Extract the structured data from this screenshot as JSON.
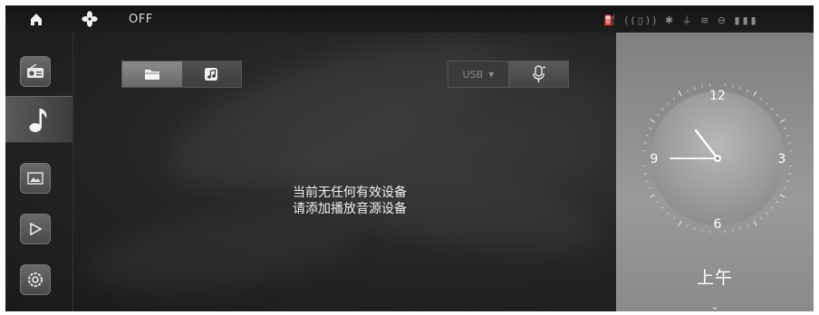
{
  "status_bar": {
    "ac_status": "OFF",
    "home_icon": "home-icon",
    "fan_icon": "fan-icon",
    "indicator_icons": "⛽ ((▯)) ✱ ⏚ ≋ ⊖ ▮▮▮"
  },
  "sidebar": {
    "items": [
      {
        "name": "radio",
        "icon": "radio-icon"
      },
      {
        "name": "music",
        "icon": "music-note-icon",
        "active": true
      },
      {
        "name": "pictures",
        "icon": "image-icon"
      },
      {
        "name": "video",
        "icon": "play-icon"
      },
      {
        "name": "apps",
        "icon": "gear-icon"
      }
    ]
  },
  "source_toggle": {
    "tabs": [
      {
        "name": "folder",
        "icon": "folder-icon",
        "selected": true
      },
      {
        "name": "music",
        "icon": "music-file-icon",
        "selected": false
      }
    ]
  },
  "usb_select": {
    "label": "USB",
    "arrow": "▼"
  },
  "voice_button": {
    "icon": "microphone-icon"
  },
  "message": {
    "line1": "当前无任何有效设备",
    "line2": "请添加播放音源设备"
  },
  "clock": {
    "numerals": [
      "12",
      "3",
      "6",
      "9"
    ],
    "ampm": "上午",
    "chevron": "⌄"
  },
  "colors": {
    "background": "#262626",
    "panel": "#8a8a8a",
    "text": "#f2f2f2"
  }
}
